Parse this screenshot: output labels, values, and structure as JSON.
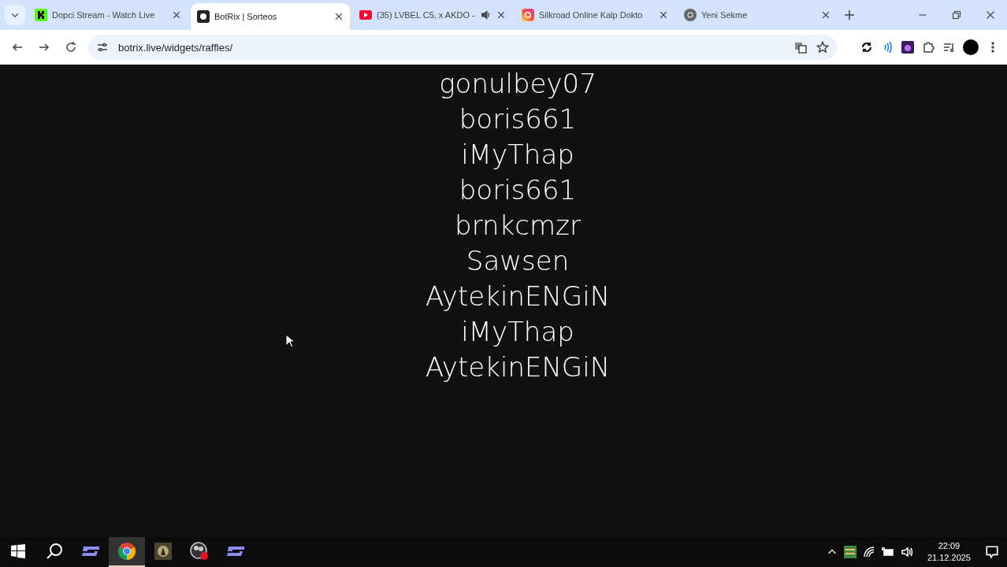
{
  "tabs": [
    {
      "kind": "kick",
      "title": "Dopci Stream - Watch Live",
      "selected": false,
      "audio": false
    },
    {
      "kind": "botrix",
      "title": "BotRix | Sorteos",
      "selected": true,
      "audio": false
    },
    {
      "kind": "youtube",
      "title": "(35) LVBEL C5, x AKDO -",
      "selected": false,
      "audio": true
    },
    {
      "kind": "instagram",
      "title": "Silkroad Online Kalp Dokto",
      "selected": false,
      "audio": false
    },
    {
      "kind": "chrome",
      "title": "Yeni Sekme",
      "selected": false,
      "audio": false
    }
  ],
  "address": "botrix.live/widgets/raffles/",
  "names": [
    "gonulbey07",
    "boris661",
    "iMyThap",
    "boris661",
    "brnkcmzr",
    "Sawsen",
    "AytekinENGiN",
    "iMyThap",
    "AytekinENGiN"
  ],
  "taskbar": {
    "apps": [
      {
        "kind": "s",
        "selected": false
      },
      {
        "kind": "chrome",
        "selected": true
      },
      {
        "kind": "game",
        "selected": false
      },
      {
        "kind": "obs",
        "selected": false
      },
      {
        "kind": "s",
        "selected": false
      }
    ],
    "time": "22:09",
    "date": "21.12.2025"
  }
}
